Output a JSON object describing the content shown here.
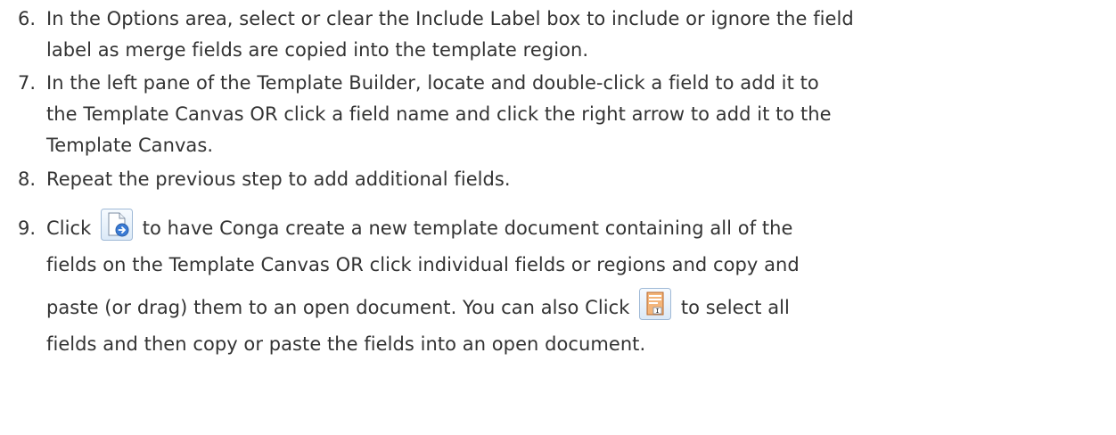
{
  "steps": [
    {
      "number": "6.",
      "lines": [
        "In the Options area, select or clear the Include Label box to include or ignore the field",
        "label as merge fields are copied into the template region."
      ]
    },
    {
      "number": "7.",
      "lines": [
        "In the left pane of the Template Builder, locate and double-click a field to add it to",
        "the Template Canvas OR click a field name and click the right arrow to add it to the",
        "Template Canvas."
      ]
    },
    {
      "number": "8.",
      "lines": [
        "Repeat the previous step to add additional fields."
      ]
    },
    {
      "number": "9.",
      "line1_before": "Click",
      "line1_after": "to have Conga create a new template document containing all of the",
      "line2": "fields on the Template Canvas OR click individual fields or regions and copy and",
      "line3_before": "paste (or drag) them to an open document. You can also Click",
      "line3_after": "to select all",
      "line4": "fields and then copy or paste the fields into an open document.",
      "icon_new_document": "new-template-document-icon",
      "icon_select_all": "select-all-fields-icon"
    }
  ],
  "colors": {
    "text": "#333333",
    "icon_blue": "#3a7bd5",
    "icon_orange": "#e8893a"
  }
}
